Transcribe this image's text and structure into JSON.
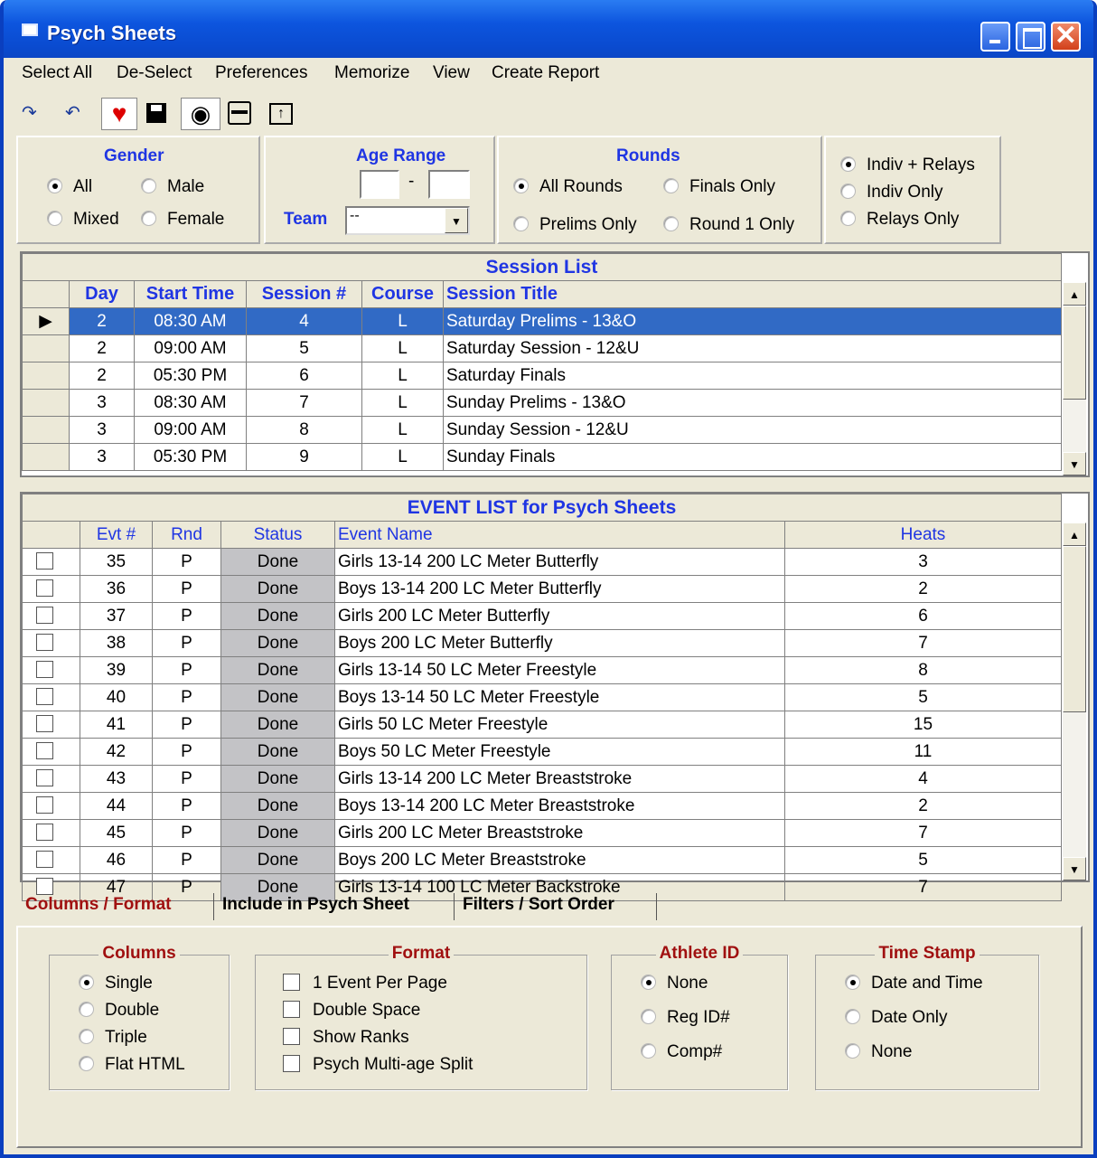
{
  "window": {
    "title": "Psych Sheets",
    "close_glyph": "✕"
  },
  "menu": [
    "Select All",
    "De-Select",
    "Preferences",
    "Memorize",
    "View",
    "Create Report"
  ],
  "toolbar_icons": [
    "redo-icon",
    "undo-icon",
    "heart-icon",
    "save-icon",
    "eye-icon",
    "print-icon",
    "export-icon"
  ],
  "gender": {
    "title": "Gender",
    "all": "All",
    "male": "Male",
    "mixed": "Mixed",
    "female": "Female",
    "selected": "All"
  },
  "age_range": {
    "title": "Age Range",
    "low": "",
    "high": "",
    "separator": "-"
  },
  "team": {
    "label": "Team",
    "value": "--"
  },
  "rounds": {
    "title": "Rounds",
    "all": "All Rounds",
    "finals": "Finals Only",
    "prelims": "Prelims Only",
    "round1": "Round 1 Only",
    "selected": "All Rounds"
  },
  "relays": {
    "both": "Indiv + Relays",
    "indiv": "Indiv Only",
    "relays": "Relays Only",
    "selected": "Indiv + Relays"
  },
  "session_list": {
    "caption": "Session List",
    "columns": [
      "Day",
      "Start Time",
      "Session #",
      "Course",
      "Session Title"
    ],
    "rows": [
      [
        "2",
        "08:30 AM",
        "4",
        "L",
        "Saturday Prelims - 13&O"
      ],
      [
        "2",
        "09:00 AM",
        "5",
        "L",
        "Saturday Session - 12&U"
      ],
      [
        "2",
        "05:30 PM",
        "6",
        "L",
        "Saturday Finals"
      ],
      [
        "3",
        "08:30 AM",
        "7",
        "L",
        "Sunday Prelims - 13&O"
      ],
      [
        "3",
        "09:00 AM",
        "8",
        "L",
        "Sunday Session - 12&U"
      ],
      [
        "3",
        "05:30 PM",
        "9",
        "L",
        "Sunday Finals"
      ]
    ],
    "selected_index": 0
  },
  "event_list": {
    "caption": "EVENT LIST for Psych Sheets",
    "columns": [
      "Evt #",
      "Rnd",
      "Status",
      "Event Name",
      "Heats"
    ],
    "rows": [
      [
        "35",
        "P",
        "Done",
        "Girls 13-14 200 LC Meter Butterfly",
        "3"
      ],
      [
        "36",
        "P",
        "Done",
        "Boys 13-14 200 LC Meter Butterfly",
        "2"
      ],
      [
        "37",
        "P",
        "Done",
        "Girls 200 LC Meter Butterfly",
        "6"
      ],
      [
        "38",
        "P",
        "Done",
        "Boys 200 LC Meter Butterfly",
        "7"
      ],
      [
        "39",
        "P",
        "Done",
        "Girls 13-14 50 LC Meter Freestyle",
        "8"
      ],
      [
        "40",
        "P",
        "Done",
        "Boys 13-14 50 LC Meter Freestyle",
        "5"
      ],
      [
        "41",
        "P",
        "Done",
        "Girls 50 LC Meter Freestyle",
        "15"
      ],
      [
        "42",
        "P",
        "Done",
        "Boys 50 LC Meter Freestyle",
        "11"
      ],
      [
        "43",
        "P",
        "Done",
        "Girls 13-14 200 LC Meter Breaststroke",
        "4"
      ],
      [
        "44",
        "P",
        "Done",
        "Boys 13-14 200 LC Meter Breaststroke",
        "2"
      ],
      [
        "45",
        "P",
        "Done",
        "Girls 200 LC Meter Breaststroke",
        "7"
      ],
      [
        "46",
        "P",
        "Done",
        "Boys 200 LC Meter Breaststroke",
        "5"
      ],
      [
        "47",
        "P",
        "Done",
        "Girls 13-14 100 LC Meter Backstroke",
        "7"
      ]
    ]
  },
  "tabs": [
    "Columns / Format",
    "Include in Psych Sheet",
    "Filters / Sort Order"
  ],
  "active_tab": "Columns / Format",
  "columns_group": {
    "title": "Columns",
    "options": [
      "Single",
      "Double",
      "Triple",
      "Flat HTML"
    ],
    "selected": "Single"
  },
  "format_group": {
    "title": "Format",
    "options": [
      "1 Event Per Page",
      "Double Space",
      "Show Ranks",
      "Psych Multi-age Split"
    ]
  },
  "athlete_group": {
    "title": "Athlete ID",
    "options": [
      "None",
      "Reg ID#",
      "Comp#"
    ],
    "selected": "None"
  },
  "timestamp_group": {
    "title": "Time Stamp",
    "options": [
      "Date and Time",
      "Date Only",
      "None"
    ],
    "selected": "Date and Time"
  },
  "colors": {
    "title_bar": "#0a4bd0",
    "header_blue": "#1f35e3",
    "group_red": "#a01010",
    "selection": "#316ac5"
  }
}
